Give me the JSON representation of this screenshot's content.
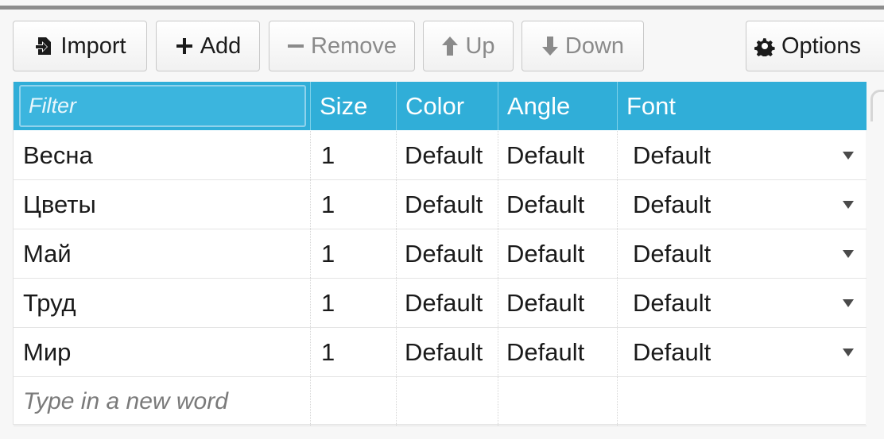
{
  "toolbar": {
    "import_label": "Import",
    "add_label": "Add",
    "remove_label": "Remove",
    "up_label": "Up",
    "down_label": "Down",
    "options_label": "Options"
  },
  "grid": {
    "filter_placeholder": "Filter",
    "columns": {
      "size": "Size",
      "color": "Color",
      "angle": "Angle",
      "font": "Font"
    },
    "rows": [
      {
        "word": "Весна",
        "size": "1",
        "color": "Default",
        "angle": "Default",
        "font": "Default"
      },
      {
        "word": "Цветы",
        "size": "1",
        "color": "Default",
        "angle": "Default",
        "font": "Default"
      },
      {
        "word": "Май",
        "size": "1",
        "color": "Default",
        "angle": "Default",
        "font": "Default"
      },
      {
        "word": "Труд",
        "size": "1",
        "color": "Default",
        "angle": "Default",
        "font": "Default"
      },
      {
        "word": "Мир",
        "size": "1",
        "color": "Default",
        "angle": "Default",
        "font": "Default"
      }
    ],
    "new_word_placeholder": "Type in a new word"
  },
  "colors": {
    "header_bg": "#30aed8",
    "header_text": "#ffffff",
    "disabled_text": "#8a8a8a"
  },
  "icons": {
    "import": "import-icon",
    "add": "plus-icon",
    "remove": "minus-icon",
    "up": "arrow-up-icon",
    "down": "arrow-down-icon",
    "options": "gear-icon",
    "font_dropdown": "chevron-down-icon"
  }
}
